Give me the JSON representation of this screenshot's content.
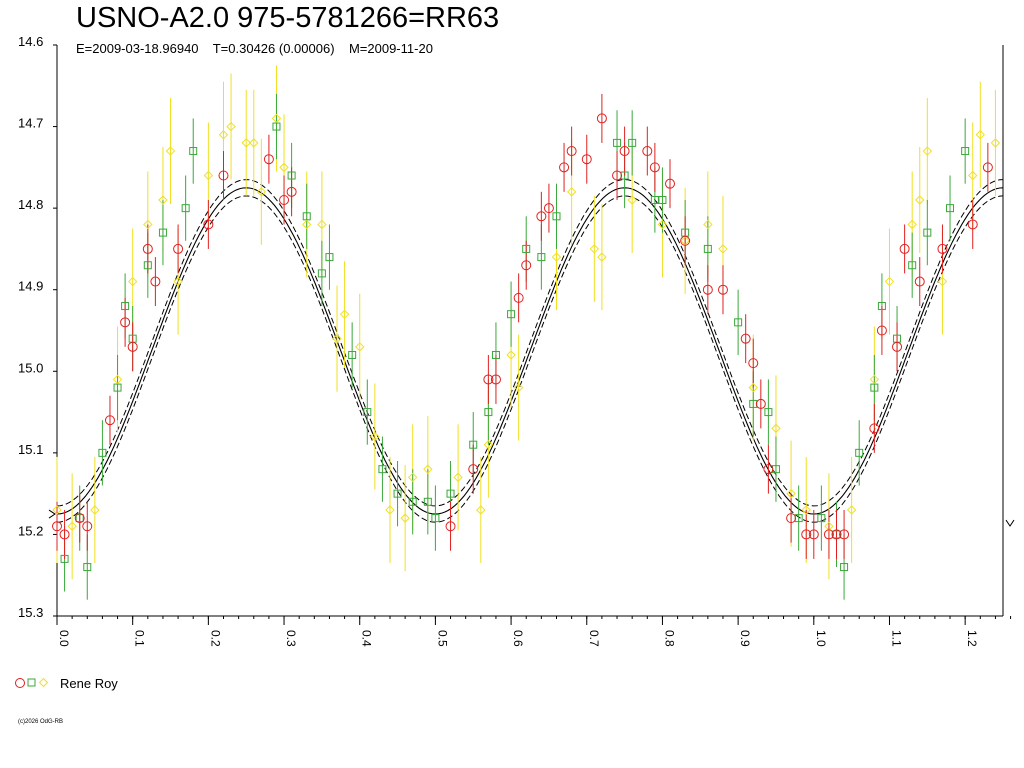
{
  "chart_data": {
    "type": "scatter",
    "title": "USNO-A2.0 975-5781266=RR63",
    "subtitle": "E=2009-03-18.96940    T=0.30426 (0.00006)    M=2009-11-20",
    "xlabel": "",
    "ylabel": "",
    "xlim": [
      0.0,
      1.25
    ],
    "ylim": [
      15.3,
      14.6
    ],
    "y_inverted": true,
    "x_ticks": [
      "0.0",
      "0.1",
      "0.2",
      "0.3",
      "0.4",
      "0.5",
      "0.6",
      "0.7",
      "0.8",
      "0.9",
      "1.0",
      "1.1",
      "1.2"
    ],
    "y_ticks": [
      "14.6",
      "14.7",
      "14.8",
      "14.9",
      "15.0",
      "15.1",
      "15.2",
      "15.3"
    ],
    "grid": false,
    "legend_position": "bottom-left",
    "fit": {
      "mean": 14.975,
      "amplitude": 0.2,
      "period_phase": 0.5,
      "minimum_phase": 0.0,
      "band": 0.01
    },
    "series": [
      {
        "name": "Rene Roy",
        "marker": "circle",
        "color": "#e02020",
        "points": [
          [
            0.0,
            15.19
          ],
          [
            0.01,
            15.2
          ],
          [
            0.03,
            15.18
          ],
          [
            0.04,
            15.19
          ],
          [
            0.07,
            15.06
          ],
          [
            0.09,
            14.94
          ],
          [
            0.1,
            14.97
          ],
          [
            0.12,
            14.85
          ],
          [
            0.13,
            14.89
          ],
          [
            0.16,
            14.85
          ],
          [
            0.2,
            14.82
          ],
          [
            0.22,
            14.76
          ],
          [
            0.28,
            14.74
          ],
          [
            0.3,
            14.79
          ],
          [
            0.31,
            14.78
          ],
          [
            0.52,
            15.19
          ],
          [
            0.55,
            15.12
          ],
          [
            0.57,
            15.01
          ],
          [
            0.58,
            15.01
          ],
          [
            0.61,
            14.91
          ],
          [
            0.62,
            14.87
          ],
          [
            0.64,
            14.81
          ],
          [
            0.65,
            14.8
          ],
          [
            0.67,
            14.75
          ],
          [
            0.68,
            14.73
          ],
          [
            0.7,
            14.74
          ],
          [
            0.72,
            14.69
          ],
          [
            0.74,
            14.76
          ],
          [
            0.75,
            14.73
          ],
          [
            0.78,
            14.73
          ],
          [
            0.79,
            14.75
          ],
          [
            0.81,
            14.77
          ],
          [
            0.83,
            14.84
          ],
          [
            0.86,
            14.9
          ],
          [
            0.88,
            14.9
          ],
          [
            0.91,
            14.96
          ],
          [
            0.92,
            14.99
          ],
          [
            0.93,
            15.04
          ],
          [
            0.94,
            15.12
          ],
          [
            0.97,
            15.18
          ],
          [
            0.99,
            15.2
          ],
          [
            1.0,
            15.2
          ],
          [
            1.02,
            15.2
          ],
          [
            1.03,
            15.2
          ],
          [
            1.04,
            15.2
          ],
          [
            1.08,
            15.07
          ],
          [
            1.09,
            14.95
          ],
          [
            1.11,
            14.97
          ],
          [
            1.12,
            14.85
          ],
          [
            1.14,
            14.89
          ],
          [
            1.17,
            14.85
          ],
          [
            1.21,
            14.82
          ],
          [
            1.23,
            14.75
          ]
        ]
      },
      {
        "name": "",
        "marker": "square",
        "color": "#3aa83a",
        "points": [
          [
            0.01,
            15.23
          ],
          [
            0.03,
            15.18
          ],
          [
            0.04,
            15.24
          ],
          [
            0.06,
            15.1
          ],
          [
            0.08,
            15.02
          ],
          [
            0.09,
            14.92
          ],
          [
            0.1,
            14.96
          ],
          [
            0.12,
            14.87
          ],
          [
            0.14,
            14.83
          ],
          [
            0.17,
            14.8
          ],
          [
            0.18,
            14.73
          ],
          [
            0.29,
            14.7
          ],
          [
            0.31,
            14.76
          ],
          [
            0.33,
            14.81
          ],
          [
            0.35,
            14.88
          ],
          [
            0.36,
            14.86
          ],
          [
            0.39,
            14.98
          ],
          [
            0.41,
            15.05
          ],
          [
            0.43,
            15.12
          ],
          [
            0.45,
            15.15
          ],
          [
            0.47,
            15.16
          ],
          [
            0.49,
            15.16
          ],
          [
            0.5,
            15.18
          ],
          [
            0.52,
            15.15
          ],
          [
            0.55,
            15.09
          ],
          [
            0.57,
            15.05
          ],
          [
            0.58,
            14.98
          ],
          [
            0.6,
            14.93
          ],
          [
            0.62,
            14.85
          ],
          [
            0.64,
            14.86
          ],
          [
            0.66,
            14.81
          ],
          [
            0.74,
            14.72
          ],
          [
            0.75,
            14.76
          ],
          [
            0.76,
            14.72
          ],
          [
            0.79,
            14.79
          ],
          [
            0.8,
            14.79
          ],
          [
            0.83,
            14.83
          ],
          [
            0.86,
            14.85
          ],
          [
            0.9,
            14.94
          ],
          [
            0.92,
            15.04
          ],
          [
            0.94,
            15.05
          ],
          [
            0.95,
            15.12
          ],
          [
            0.98,
            15.18
          ],
          [
            1.01,
            15.18
          ],
          [
            1.03,
            15.2
          ],
          [
            1.04,
            15.24
          ],
          [
            1.06,
            15.1
          ],
          [
            1.08,
            15.02
          ],
          [
            1.09,
            14.92
          ],
          [
            1.11,
            14.96
          ],
          [
            1.13,
            14.87
          ],
          [
            1.15,
            14.83
          ],
          [
            1.18,
            14.8
          ],
          [
            1.2,
            14.73
          ]
        ]
      },
      {
        "name": "",
        "marker": "diamond",
        "color": "#f0e020",
        "points": [
          [
            0.0,
            15.17
          ],
          [
            0.02,
            15.19
          ],
          [
            0.05,
            15.17
          ],
          [
            0.08,
            15.01
          ],
          [
            0.1,
            14.89
          ],
          [
            0.12,
            14.82
          ],
          [
            0.14,
            14.79
          ],
          [
            0.15,
            14.73
          ],
          [
            0.16,
            14.89
          ],
          [
            0.2,
            14.76
          ],
          [
            0.22,
            14.71
          ],
          [
            0.23,
            14.7
          ],
          [
            0.25,
            14.72
          ],
          [
            0.26,
            14.72
          ],
          [
            0.27,
            14.78
          ],
          [
            0.29,
            14.69
          ],
          [
            0.3,
            14.75
          ],
          [
            0.33,
            14.82
          ],
          [
            0.35,
            14.82
          ],
          [
            0.37,
            14.96
          ],
          [
            0.38,
            14.93
          ],
          [
            0.4,
            14.97
          ],
          [
            0.42,
            15.08
          ],
          [
            0.44,
            15.17
          ],
          [
            0.46,
            15.18
          ],
          [
            0.47,
            15.13
          ],
          [
            0.49,
            15.12
          ],
          [
            0.53,
            15.13
          ],
          [
            0.56,
            15.17
          ],
          [
            0.57,
            15.09
          ],
          [
            0.6,
            14.98
          ],
          [
            0.61,
            15.02
          ],
          [
            0.66,
            14.86
          ],
          [
            0.68,
            14.78
          ],
          [
            0.71,
            14.85
          ],
          [
            0.72,
            14.86
          ],
          [
            0.76,
            14.79
          ],
          [
            0.8,
            14.82
          ],
          [
            0.83,
            14.84
          ],
          [
            0.86,
            14.82
          ],
          [
            0.88,
            14.85
          ],
          [
            0.92,
            15.02
          ],
          [
            0.95,
            15.07
          ],
          [
            0.97,
            15.15
          ],
          [
            0.99,
            15.17
          ],
          [
            1.02,
            15.19
          ],
          [
            1.05,
            15.17
          ],
          [
            1.08,
            15.01
          ],
          [
            1.1,
            14.89
          ],
          [
            1.13,
            14.82
          ],
          [
            1.14,
            14.79
          ],
          [
            1.15,
            14.73
          ],
          [
            1.17,
            14.89
          ],
          [
            1.21,
            14.76
          ],
          [
            1.22,
            14.71
          ],
          [
            1.24,
            14.72
          ]
        ]
      }
    ]
  },
  "legend": {
    "label": "Rene Roy"
  },
  "footer": {
    "copyright": "(c)2026 OdG-RB"
  }
}
